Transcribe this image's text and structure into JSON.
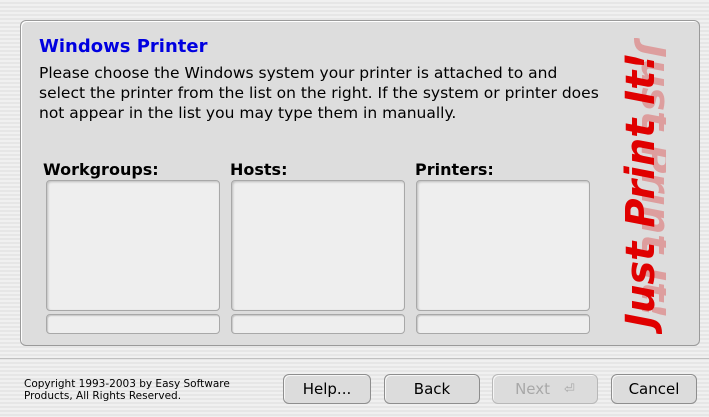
{
  "window": {
    "title": "Windows Printer",
    "description": "Please choose the Windows system your printer is attached to and select the printer from the list on the right. If the system or printer does not appear in the list you may type them in manually."
  },
  "columns": {
    "workgroups": {
      "label": "Workgroups:",
      "items": [],
      "value": ""
    },
    "hosts": {
      "label": "Hosts:",
      "items": [],
      "value": ""
    },
    "printers": {
      "label": "Printers:",
      "items": [],
      "value": ""
    }
  },
  "logo": {
    "text": "Just Print It!",
    "color": "#e00000",
    "icon": "just-print-it-logo"
  },
  "footer": {
    "copyright_line1": "Copyright 1993-2003 by Easy Software",
    "copyright_line2": "Products, All Rights Reserved.",
    "help_label": "Help...",
    "back_label": "Back",
    "next_label": "Next",
    "next_icon": "enter-arrow-icon",
    "cancel_label": "Cancel"
  }
}
